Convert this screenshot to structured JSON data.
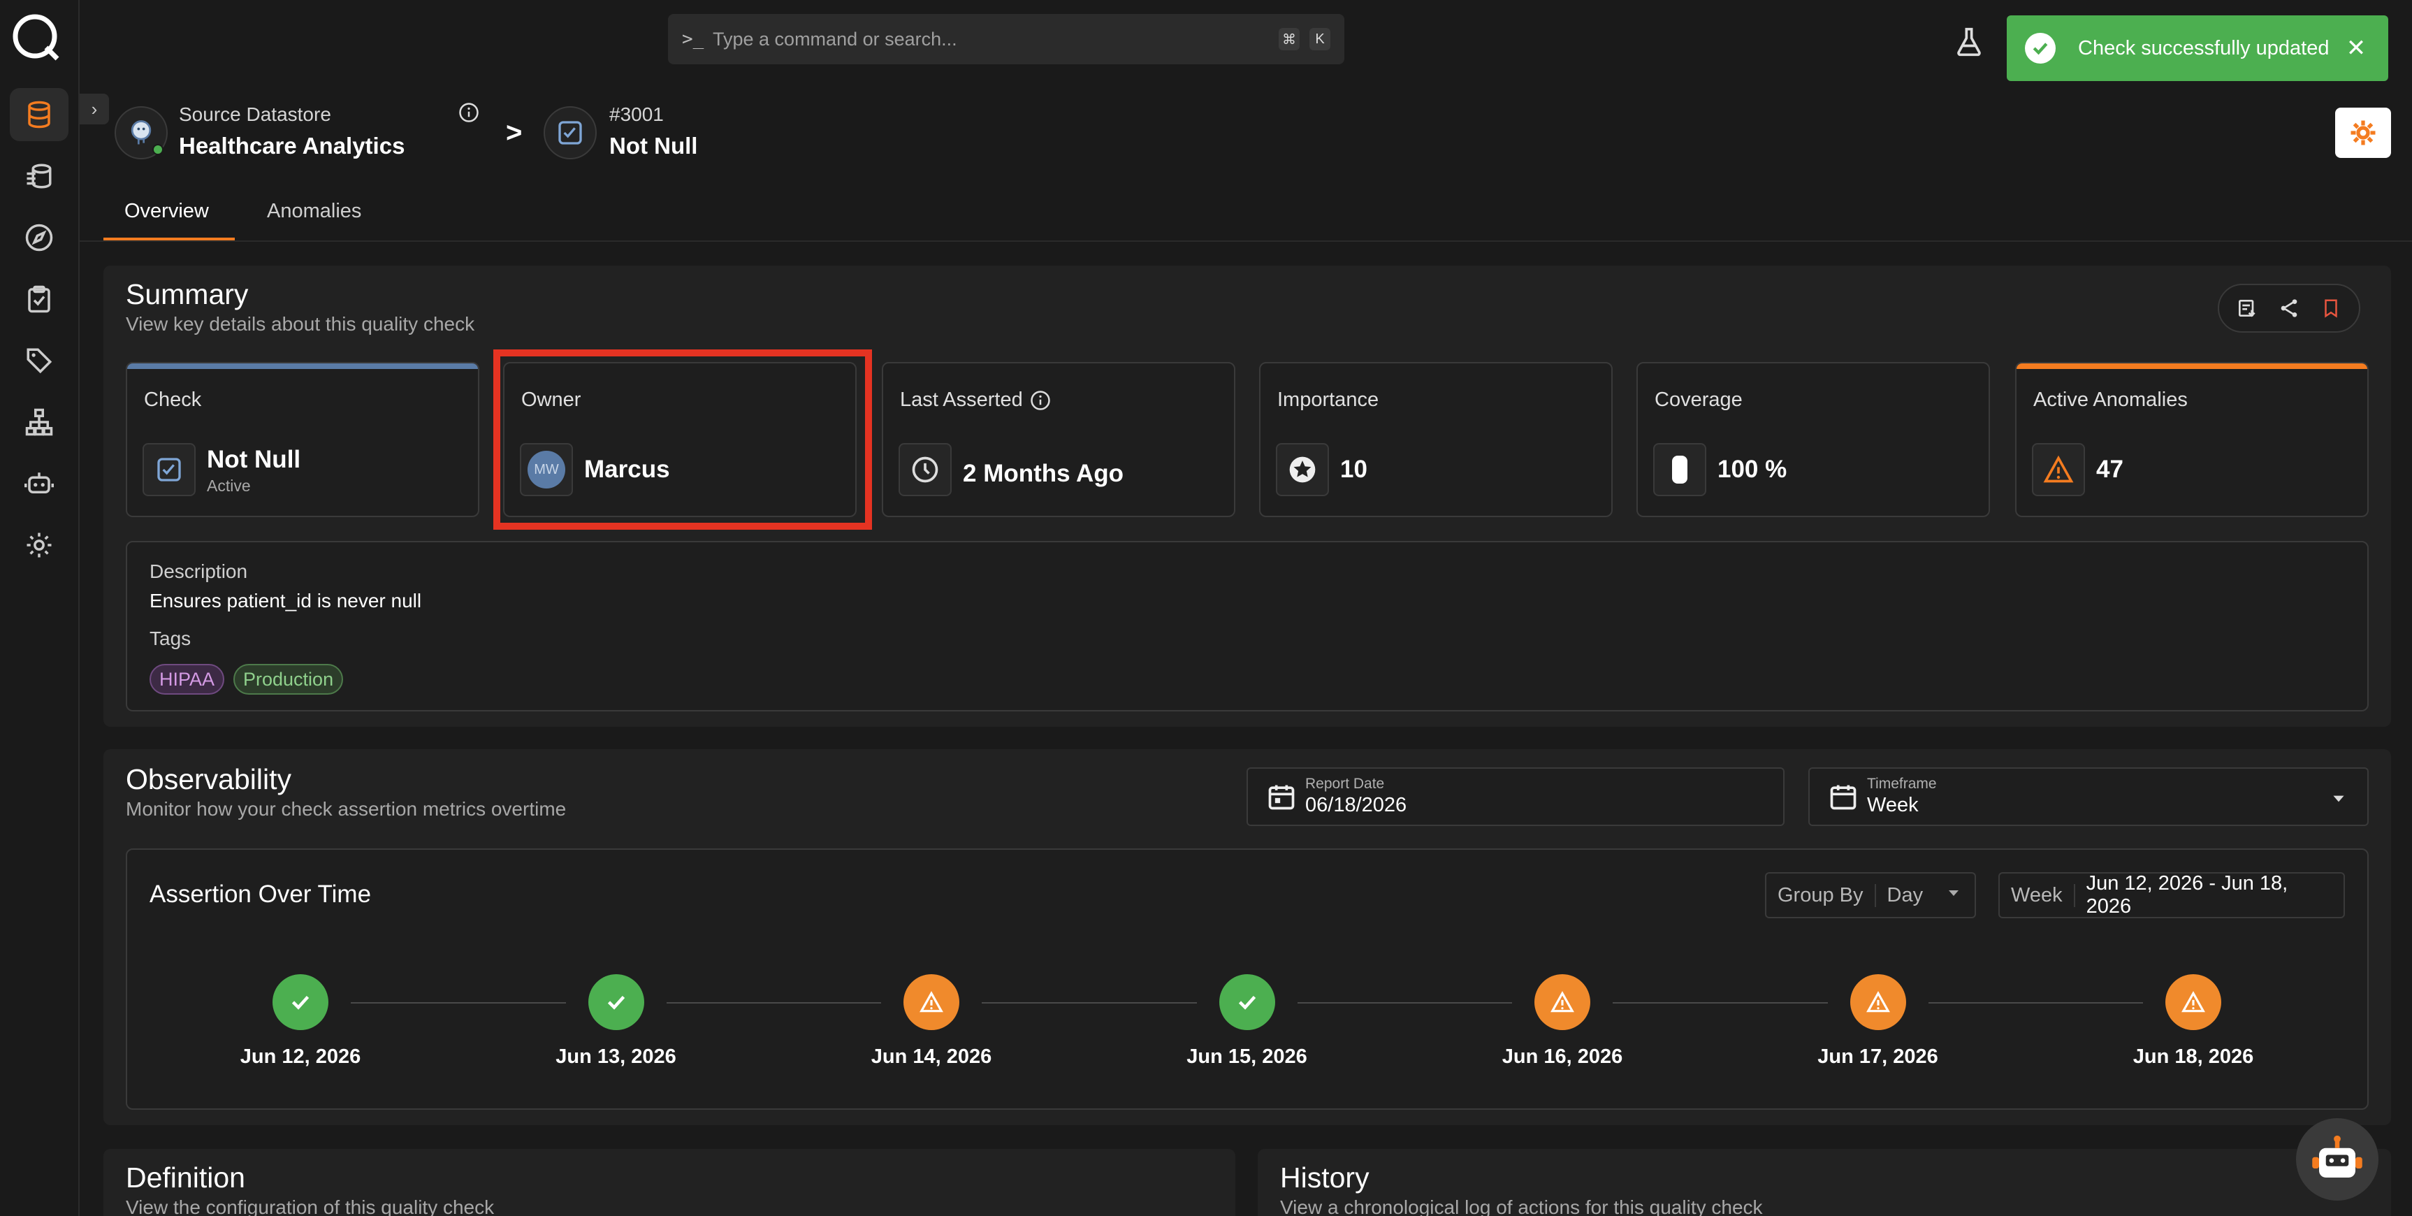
{
  "search": {
    "placeholder": "Type a command or search...",
    "prompt_glyph": ">_",
    "shortcut_keys": [
      "⌘",
      "K"
    ]
  },
  "toast": {
    "message": "Check successfully updated",
    "close": "✕",
    "color": "#4caf50"
  },
  "breadcrumb": {
    "datastore_label": "Source Datastore",
    "datastore_name": "Healthcare Analytics",
    "datastore_status_color": "#4caf50",
    "separator": ">",
    "check_id": "#3001",
    "check_name": "Not Null"
  },
  "tabs": [
    {
      "label": "Overview",
      "active": true
    },
    {
      "label": "Anomalies",
      "active": false
    }
  ],
  "summary": {
    "title": "Summary",
    "subtitle": "View key details about this quality check",
    "cards": {
      "check": {
        "title": "Check",
        "value": "Not Null",
        "status": "Active"
      },
      "owner": {
        "title": "Owner",
        "initials": "MW",
        "value": "Marcus"
      },
      "last_asserted": {
        "title": "Last Asserted",
        "value": "2 Months Ago"
      },
      "importance": {
        "title": "Importance",
        "value": "10"
      },
      "coverage": {
        "title": "Coverage",
        "value": "100 %"
      },
      "active_anomalies": {
        "title": "Active Anomalies",
        "value": "47"
      }
    },
    "description_label": "Description",
    "description": "Ensures patient_id is never null",
    "tags_label": "Tags",
    "tags": [
      {
        "label": "HIPAA",
        "color": "#c98ad8"
      },
      {
        "label": "Production",
        "color": "#7cc47f"
      }
    ]
  },
  "observability": {
    "title": "Observability",
    "subtitle": "Monitor how your check assertion metrics overtime",
    "report_date_label": "Report Date",
    "report_date": "06/18/2026",
    "timeframe_label": "Timeframe",
    "timeframe": "Week",
    "assertion_title": "Assertion Over Time",
    "group_by_label": "Group By",
    "group_by": "Day",
    "range_label": "Week",
    "range": "Jun 12, 2026 - Jun 18, 2026",
    "timeline": [
      {
        "date": "Jun 12, 2026",
        "status": "pass"
      },
      {
        "date": "Jun 13, 2026",
        "status": "pass"
      },
      {
        "date": "Jun 14, 2026",
        "status": "warn"
      },
      {
        "date": "Jun 15, 2026",
        "status": "pass"
      },
      {
        "date": "Jun 16, 2026",
        "status": "warn"
      },
      {
        "date": "Jun 17, 2026",
        "status": "warn"
      },
      {
        "date": "Jun 18, 2026",
        "status": "warn"
      }
    ]
  },
  "definition": {
    "title": "Definition",
    "subtitle": "View the configuration of this quality check"
  },
  "history": {
    "title": "History",
    "subtitle": "View a chronological log of actions for this quality check"
  },
  "colors": {
    "accent": "#f47c20",
    "pass": "#4caf50",
    "warn": "#f08a2c",
    "highlight": "#e53322",
    "check_bar": "#5a7ba6",
    "anomaly_bar": "#f47c20"
  }
}
